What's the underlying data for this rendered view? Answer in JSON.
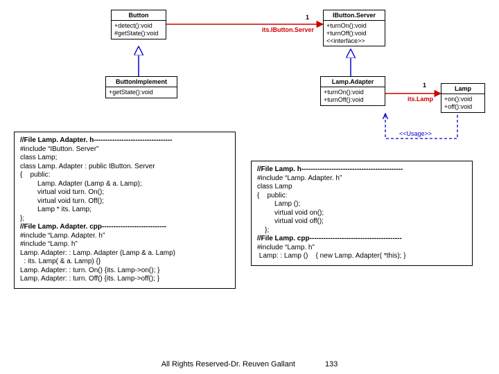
{
  "uml": {
    "button": {
      "title": "Button",
      "ops": [
        "+detect():void",
        "#getState():void"
      ]
    },
    "ibuttonserver": {
      "title": "IButton.Server",
      "ops": [
        "+turnOn():void",
        "+turnOff():void",
        "<<interface>>"
      ]
    },
    "buttonimpl": {
      "title": "ButtonImplement",
      "ops": [
        "+getState():void"
      ]
    },
    "lampadapter": {
      "title": "Lamp.Adapter",
      "ops": [
        "+turnOn():void",
        "+turnOff():void"
      ]
    },
    "lamp": {
      "title": "Lamp",
      "ops": [
        "+on():void",
        "+off():void"
      ]
    }
  },
  "labels": {
    "mult1a": "1",
    "assoc1": "its.IButton.Server",
    "mult1b": "1",
    "assoc2": "its.Lamp",
    "usage": "<<Usage>>"
  },
  "codeLeft": {
    "l0": "//File Lamp. Adapter. h----------------------------------",
    "l1": "#include “IButton. Server”",
    "l2": "class Lamp;",
    "l3": "class Lamp. Adapter : public IButton. Server",
    "l4": "{    public:",
    "l5": "         Lamp. Adapter (Lamp & a. Lamp);",
    "l6": "         virtual void turn. On();",
    "l7": "         virtual void turn. Off();",
    "l8": "         Lamp * its. Lamp;",
    "l9": "};",
    "l10": "//File Lamp. Adapter. cpp----------------------------",
    "l11": "#include “Lamp. Adapter. h”",
    "l12": "#include “Lamp. h”",
    "l13": "Lamp. Adapter: : Lamp. Adapter (Lamp & a. Lamp)",
    "l14": "  : its. Lamp( & a. Lamp) {}",
    "l15": "Lamp. Adapter: : turn. On() {its. Lamp->on(); }",
    "l16": "Lamp. Adapter: : turn. Off() {its. Lamp->off(); }"
  },
  "codeRight": {
    "l0": "//File Lamp. h--------------------------------------------",
    "l1": "#include “Lamp. Adapter. h”",
    "l2": "class Lamp",
    "l3": "{    public:",
    "l4": "         Lamp ();",
    "l5": "         virtual void on();",
    "l6": "         virtual void off();",
    "l7": "    };",
    "l8": "//File Lamp. cpp----------------------------------------",
    "l9": "#include “Lamp. h”",
    "l10": " Lamp: : Lamp ()    { new Lamp. Adapter( *this); }"
  },
  "footer": {
    "text": "All Rights Reserved-Dr. Reuven Gallant",
    "page": "133"
  }
}
